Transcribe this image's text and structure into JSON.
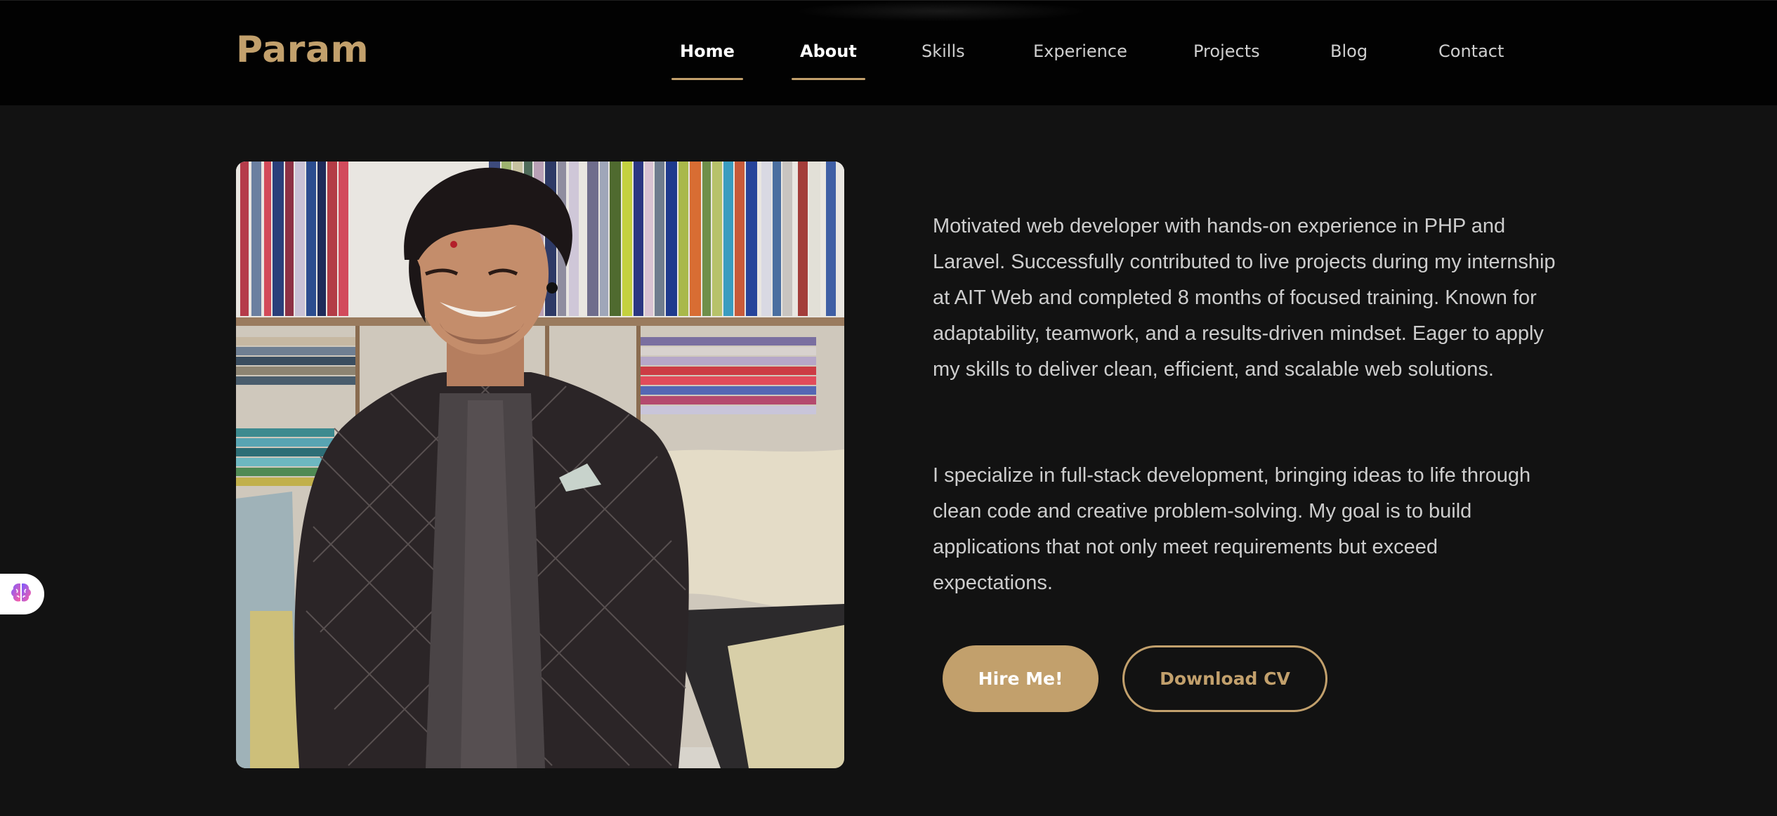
{
  "brand": {
    "name": "Param",
    "accent_color": "#c2a06c"
  },
  "nav": {
    "items": [
      {
        "label": "Home",
        "active": true
      },
      {
        "label": "About",
        "active": true
      },
      {
        "label": "Skills",
        "active": false
      },
      {
        "label": "Experience",
        "active": false
      },
      {
        "label": "Projects",
        "active": false
      },
      {
        "label": "Blog",
        "active": false
      },
      {
        "label": "Contact",
        "active": false
      }
    ]
  },
  "about": {
    "photo_alt": "Portrait of a man in an embroidered black jacket in a fabric shop",
    "paragraph1": "Motivated web developer with hands-on experience in PHP and Laravel. Successfully contributed to live projects during my internship at AIT Web and completed 8 months of focused training. Known for adaptability, teamwork, and a results-driven mindset. Eager to apply my skills to deliver clean, efficient, and scalable web solutions.",
    "paragraph2": "I specialize in full-stack development, bringing ideas to life through clean code and creative problem-solving. My goal is to build applications that not only meet requirements but exceed expectations.",
    "hire_label": "Hire Me!",
    "cv_label": "Download CV"
  },
  "widget": {
    "icon": "brain-icon"
  }
}
